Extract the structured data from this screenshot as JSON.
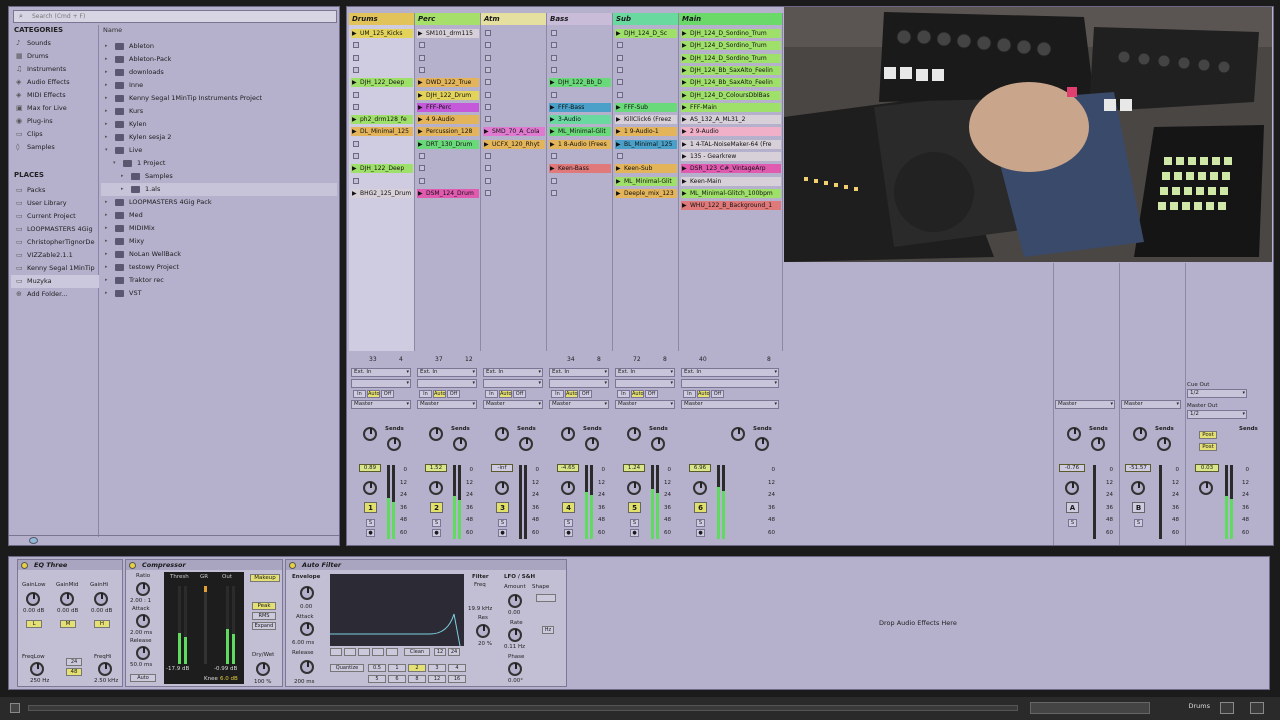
{
  "browser": {
    "search_placeholder": "Search (Cmd + F)",
    "categories_title": "CATEGORIES",
    "categories": [
      "Sounds",
      "Drums",
      "Instruments",
      "Audio Effects",
      "MIDI Effects",
      "Max for Live",
      "Plug-ins",
      "Clips",
      "Samples"
    ],
    "places_title": "PLACES",
    "places": [
      "Packs",
      "User Library",
      "Current Project",
      "LOOPMASTERS 4Gig",
      "ChristopherTignorDe",
      "VIZZable2.1.1",
      "Kenny Segal 1MinTip",
      "Muzyka",
      "Add Folder..."
    ],
    "name_header": "Name",
    "files": [
      {
        "name": "Ableton",
        "depth": 0,
        "open": false
      },
      {
        "name": "Ableton-Pack",
        "depth": 0,
        "open": false
      },
      {
        "name": "downloads",
        "depth": 0,
        "open": false
      },
      {
        "name": "Inne",
        "depth": 0,
        "open": false
      },
      {
        "name": "Kenny Segal 1MinTip Instruments Project",
        "depth": 0,
        "open": false
      },
      {
        "name": "Kurs",
        "depth": 0,
        "open": false
      },
      {
        "name": "Kylen",
        "depth": 0,
        "open": false
      },
      {
        "name": "Kylen sesja 2",
        "depth": 0,
        "open": false
      },
      {
        "name": "Live",
        "depth": 0,
        "open": true
      },
      {
        "name": "1 Project",
        "depth": 1,
        "open": true
      },
      {
        "name": "Samples",
        "depth": 2,
        "open": false
      },
      {
        "name": "1.als",
        "depth": 2,
        "open": false
      },
      {
        "name": "LOOPMASTERS 4Gig Pack",
        "depth": 0,
        "open": false
      },
      {
        "name": "Med",
        "depth": 0,
        "open": false
      },
      {
        "name": "MIDIMix",
        "depth": 0,
        "open": false
      },
      {
        "name": "Mixy",
        "depth": 0,
        "open": false
      },
      {
        "name": "NoLan WellBack",
        "depth": 0,
        "open": false
      },
      {
        "name": "testowy Project",
        "depth": 0,
        "open": false
      },
      {
        "name": "Traktor rec",
        "depth": 0,
        "open": false
      },
      {
        "name": "VST",
        "depth": 0,
        "open": false
      }
    ]
  },
  "session": {
    "tracks": [
      {
        "name": "Drums",
        "color": "#e1c35a",
        "clips": [
          "UM_125_Kicks",
          "",
          "",
          "",
          "DJH_122_Deep",
          "",
          "",
          "ph2_drm128_fe",
          "DL_Minimal_125",
          "",
          "",
          "DJH_122_Deep",
          "",
          "BHG2_125_Drum"
        ],
        "colors": [
          "#e3d35a",
          "",
          "",
          "",
          "#9fe06a",
          "",
          "",
          "#9fe06a",
          "#e3b45a",
          "",
          "",
          "#9fe06a",
          "",
          "#d7d0d8"
        ],
        "num": "1",
        "vol": "0.89",
        "cpu1": "33",
        "cpu2": "4"
      },
      {
        "name": "Perc",
        "color": "#a6e06a",
        "clips": [
          "SM101_drm115",
          "",
          "",
          "",
          "DWD_122_True",
          "DJH_122_Drum",
          "FFF-Perc",
          "4 9-Audio",
          "Percussion_128",
          "DRT_130_Drum",
          "",
          "",
          "",
          "DSM_124_Drum"
        ],
        "colors": [
          "#d7d0d8",
          "",
          "",
          "",
          "#e3b45a",
          "#e3d35a",
          "#c45ad9",
          "#e3b45a",
          "#e3b45a",
          "#6ad97a",
          "",
          "",
          "",
          "#e05ab0"
        ],
        "num": "2",
        "vol": "1.52",
        "cpu1": "37",
        "cpu2": "12"
      },
      {
        "name": "Atm",
        "color": "#e6e0a0",
        "clips": [
          "",
          "",
          "",
          "",
          "",
          "",
          "",
          "",
          "SMD_70_A_Cola",
          "UCFX_120_Rhyt",
          "",
          "",
          "",
          ""
        ],
        "colors": [
          "",
          "",
          "",
          "",
          "",
          "",
          "",
          "",
          "#e07ad0",
          "#e3b45a",
          "",
          "",
          "",
          ""
        ],
        "num": "3",
        "vol": "-inf",
        "cpu1": "",
        "cpu2": ""
      },
      {
        "name": "Bass",
        "color": "#c8bcd8",
        "clips": [
          "",
          "",
          "",
          "",
          "DJH_122_Bb_D",
          "",
          "FFF-Bass",
          "3-Audio",
          "ML_Minimal-Glit",
          "1 8-Audio (Frees",
          "",
          "Keen-Bass",
          "",
          ""
        ],
        "colors": [
          "",
          "",
          "",
          "",
          "#6ad97a",
          "",
          "#4aa0c8",
          "#6ad9a0",
          "#6ad97a",
          "#e3b45a",
          "",
          "#e07a7a",
          "",
          ""
        ],
        "num": "4",
        "vol": "-4.65",
        "cpu1": "34",
        "cpu2": "8"
      },
      {
        "name": "Sub",
        "color": "#6ad9a0",
        "clips": [
          "DJH_124_D_Sc",
          "",
          "",
          "",
          "",
          "",
          "FFF-Sub",
          "KillClick6 (Freez",
          "1 9-Audio-1",
          "BL_Minimal_125",
          "",
          "Keen-Sub",
          "ML_Minimal-Glit",
          "Deeple_mix_123"
        ],
        "colors": [
          "#9fe06a",
          "",
          "",
          "",
          "",
          "",
          "#6ad97a",
          "#d7d0d8",
          "#e3b45a",
          "#4aa0c8",
          "",
          "#e3b45a",
          "#9fe06a",
          "#e3b45a"
        ],
        "num": "5",
        "vol": "1.24",
        "cpu1": "72",
        "cpu2": "8"
      },
      {
        "name": "Main",
        "color": "#6ad96a",
        "clips": [
          "DJH_124_D_Sordino_Trum",
          "DJH_124_D_Sordino_Trum",
          "DJH_124_D_Sordino_Trum",
          "DJH_124_Bb_SaxAlto_Feelin",
          "DJH_124_Bb_SaxAlto_Feelin",
          "DJH_124_D_ColoursDblBas",
          "FFF-Main",
          "AS_132_A_ML31_2",
          "2 9-Audio",
          "1 4-TAL-NoiseMaker-64 (Fre",
          "135 - Gearkrew",
          "DSR_123_C#_VintageArp",
          "Keen-Main",
          "ML_Minimal-Glitch_100bpm",
          "WHU_122_B_Background_1"
        ],
        "colors": [
          "#9fe06a",
          "#9fe06a",
          "#9fe06a",
          "#9fe06a",
          "#9fe06a",
          "#9fe06a",
          "#9fe06a",
          "#d7d0d8",
          "#f0b0c8",
          "#d7d0d8",
          "#d7d0d8",
          "#e05ab0",
          "#d7d0d8",
          "#9fe06a",
          "#e07a7a"
        ],
        "num": "6",
        "vol": "6.96",
        "cpu1": "40",
        "cpu2": "8"
      }
    ],
    "input_label": "Ext. In",
    "in_label": "In",
    "auto_label": "Auto",
    "off_label": "Off",
    "output_label": "Master",
    "sends_label": "Sends",
    "returns": [
      {
        "letter": "A",
        "vol": "-0.76"
      },
      {
        "letter": "B",
        "vol": "-51.57"
      }
    ],
    "master": {
      "vol": "0.03",
      "cue_out": "Cue Out",
      "cue_val": "1/2",
      "master_out": "Master Out",
      "master_val": "1/2",
      "post_label": "Post"
    },
    "scale": [
      "0",
      "12",
      "24",
      "36",
      "48",
      "60"
    ]
  },
  "devices": {
    "eq": {
      "title": "EQ Three",
      "labels": [
        "GainLow",
        "GainMid",
        "GainHi"
      ],
      "values": [
        "0.00 dB",
        "0.00 dB",
        "0.00 dB"
      ],
      "buttons": [
        "L",
        "M",
        "H"
      ],
      "freqlow": "FreqLow",
      "freqhi": "FreqHi",
      "freqlow_val": "250 Hz",
      "freqhi_val": "2.50 kHz",
      "slope1": "24",
      "slope2": "48"
    },
    "comp": {
      "title": "Compressor",
      "ratio": "Ratio",
      "ratio_val": "2.00 : 1",
      "attack": "Attack",
      "attack_val": "2.00 ms",
      "release": "Release",
      "release_val": "50.0 ms",
      "auto": "Auto",
      "thresh": "Thresh",
      "gr": "GR",
      "out": "Out",
      "thresh_val": "-17.9 dB",
      "out_val": "-0.99 dB",
      "makeup": "Makeup",
      "peak": "Peak",
      "rms": "RMS",
      "expand": "Expand",
      "drywet": "Dry/Wet",
      "drywet_val": "100 %",
      "knee": "Knee",
      "knee_val": "6.0 dB"
    },
    "filter": {
      "title": "Auto Filter",
      "envelope": "Envelope",
      "env_val": "0.00",
      "attack": "Attack",
      "attack_val": "6.00 ms",
      "release": "Release",
      "release_val": "200 ms",
      "filter": "Filter",
      "freq": "Freq",
      "freq_val": "19.9 kHz",
      "res": "Res",
      "res_val": "20 %",
      "lfo": "LFO / S&H",
      "amount": "Amount",
      "amount_val": "0.00",
      "rate": "Rate",
      "rate_val": "0.11 Hz",
      "phase": "Phase",
      "phase_val": "0.00°",
      "shape": "Shape",
      "clean": "Clean",
      "quantize": "Quantize",
      "q_vals": [
        "0.5",
        "1",
        "2",
        "3",
        "4",
        "5",
        "6",
        "8",
        "12",
        "16"
      ],
      "slopes": [
        "12",
        "24"
      ],
      "hz": "Hz"
    },
    "drop_text": "Drop Audio Effects Here"
  },
  "statusbar": {
    "right": "Drums"
  }
}
